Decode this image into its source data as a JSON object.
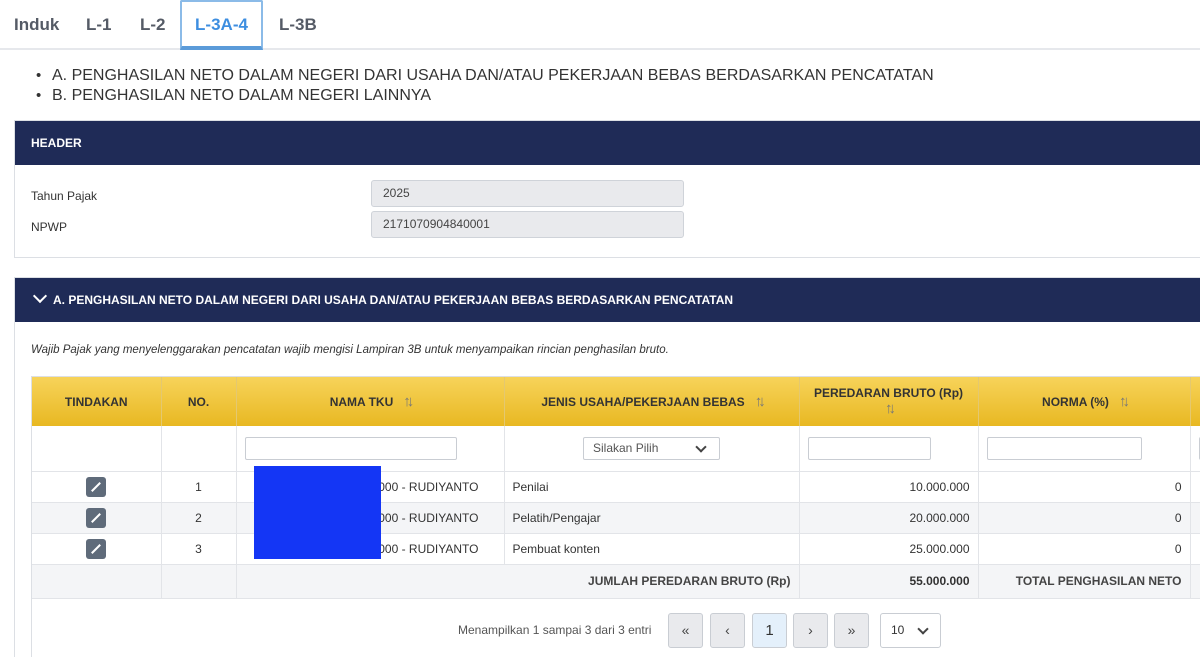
{
  "tabs": [
    "Induk",
    "L-1",
    "L-2",
    "L-3A-4",
    "L-3B"
  ],
  "active_tab": "L-3A-4",
  "sections_list": [
    "A. PENGHASILAN NETO DALAM NEGERI DARI USAHA DAN/ATAU PEKERJAAN BEBAS BERDASARKAN PENCATATAN",
    "B. PENGHASILAN NETO DALAM NEGERI LAINNYA"
  ],
  "header": {
    "title": "HEADER",
    "tahun_pajak_label": "Tahun Pajak",
    "tahun_pajak_value": "2025",
    "npwp_label": "NPWP",
    "npwp_value": "2171070904840001"
  },
  "section_a": {
    "title": "A. PENGHASILAN NETO DALAM NEGERI DARI USAHA DAN/ATAU PEKERJAAN BEBAS BERDASARKAN PENCATATAN",
    "note": "Wajib Pajak yang menyelenggarakan pencatatan wajib mengisi Lampiran 3B untuk menyampaikan rincian penghasilan bruto.",
    "columns": {
      "tindakan": "TINDAKAN",
      "no": "NO.",
      "nama_tku": "NAMA TKU",
      "jenis_usaha": "JENIS USAHA/PEKERJAAN BEBAS",
      "peredaran_bruto": "PEREDARAN BRUTO (Rp)",
      "norma": "NORMA (%)"
    },
    "filter_select_placeholder": "Silakan Pilih",
    "rows": [
      {
        "no": "1",
        "nama_tku": "00000 - RUDIYANTO",
        "jenis": "Penilai",
        "bruto": "10.000.000",
        "norma": "0"
      },
      {
        "no": "2",
        "nama_tku": "00000 - RUDIYANTO",
        "jenis": "Pelatih/Pengajar",
        "bruto": "20.000.000",
        "norma": "0"
      },
      {
        "no": "3",
        "nama_tku": "00000 - RUDIYANTO",
        "jenis": "Pembuat konten",
        "bruto": "25.000.000",
        "norma": "0"
      }
    ],
    "total_bruto_label": "JUMLAH PEREDARAN BRUTO (Rp)",
    "total_bruto_value": "55.000.000",
    "total_neto_label": "TOTAL PENGHASILAN NETO",
    "pagination": {
      "info": "Menampilkan 1 sampai 3 dari 3 entri",
      "current_page": "1",
      "page_size": "10"
    }
  },
  "icons": {
    "edit": "edit-icon",
    "first": "«",
    "prev": "‹",
    "next": "›",
    "last": "»",
    "sort": "↑↓"
  }
}
